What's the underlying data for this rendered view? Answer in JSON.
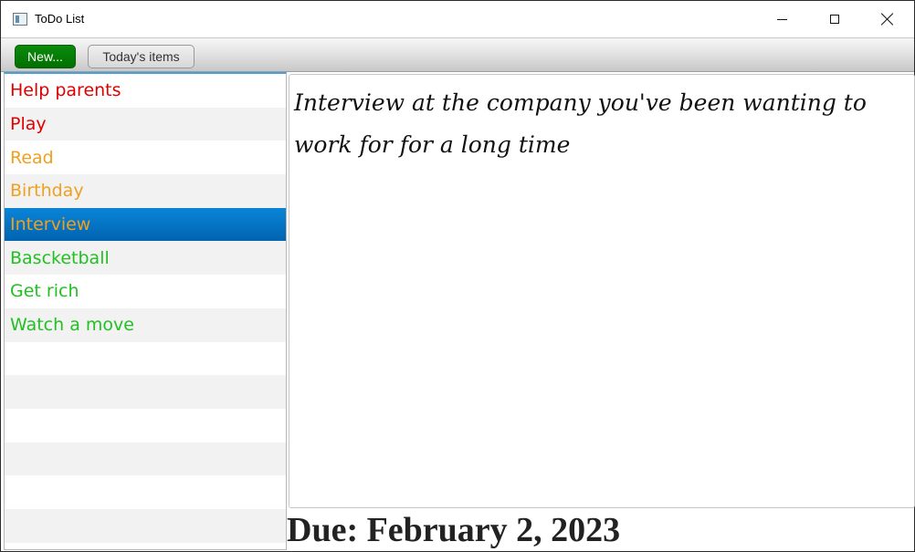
{
  "window": {
    "title": "ToDo List"
  },
  "toolbar": {
    "new_label": "New...",
    "today_label": "Today's items"
  },
  "todo_list": {
    "items": [
      {
        "label": "Help parents",
        "color": "#e00000"
      },
      {
        "label": "Play",
        "color": "#e00000"
      },
      {
        "label": "Read",
        "color": "#f0a020"
      },
      {
        "label": "Birthday",
        "color": "#f0a020"
      },
      {
        "label": "Interview",
        "color": "#f0a020",
        "selected": true
      },
      {
        "label": "Bascketball",
        "color": "#22c022"
      },
      {
        "label": "Get rich",
        "color": "#22c022"
      },
      {
        "label": "Watch a move",
        "color": "#22c022"
      },
      {
        "label": ""
      },
      {
        "label": ""
      },
      {
        "label": ""
      },
      {
        "label": ""
      },
      {
        "label": ""
      },
      {
        "label": ""
      }
    ]
  },
  "detail": {
    "description": "Interview at the company you've been wanting to work for for a long time",
    "due": "Due: February 2, 2023"
  },
  "colors": {
    "accent": "#0078d7",
    "new_button": "#078007"
  },
  "icons": {
    "app": "app-window-icon",
    "minimize": "minimize-icon",
    "maximize": "maximize-icon",
    "close": "close-icon"
  }
}
